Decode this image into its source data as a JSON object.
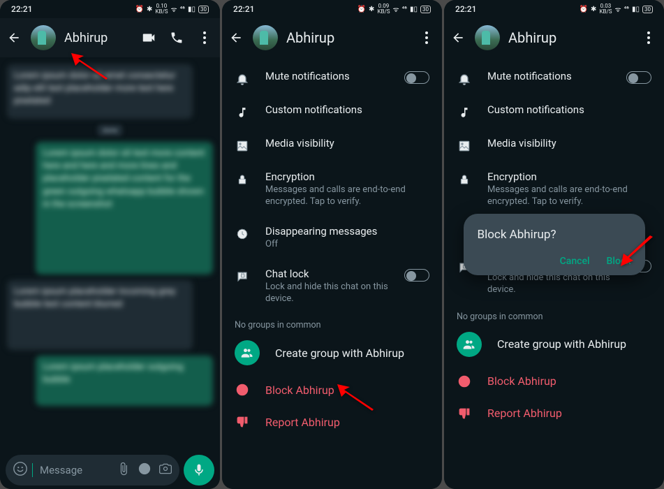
{
  "status": {
    "time": "22:21",
    "net1": "0.10",
    "net2": "0.09",
    "net3": "0.03",
    "unit": "KB/S",
    "battery": "30"
  },
  "contact": {
    "name": "Abhirup"
  },
  "chat": {
    "placeholder": "Message"
  },
  "settings": {
    "mute": {
      "title": "Mute notifications"
    },
    "custom": {
      "title": "Custom notifications"
    },
    "media": {
      "title": "Media visibility"
    },
    "encryption": {
      "title": "Encryption",
      "sub": "Messages and calls are end-to-end encrypted. Tap to verify."
    },
    "disappearing": {
      "title": "Disappearing messages",
      "sub": "Off"
    },
    "chatlock": {
      "title": "Chat lock",
      "sub": "Lock and hide this chat on this device."
    },
    "no_groups": "No groups in common",
    "create_group": "Create group with Abhirup",
    "block": "Block Abhirup",
    "report": "Report Abhirup"
  },
  "dialog": {
    "title": "Block Abhirup?",
    "cancel": "Cancel",
    "block": "Block"
  }
}
